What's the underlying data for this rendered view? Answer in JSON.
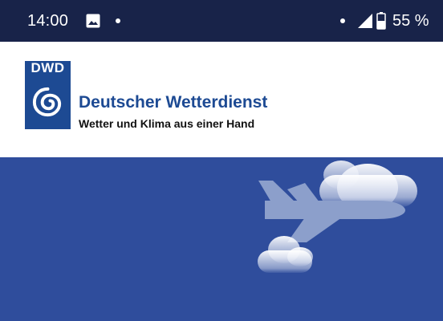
{
  "status_bar": {
    "time": "14:00",
    "battery_percent": "55 %",
    "icons": [
      "gallery-icon",
      "notification-dot-icon",
      "signal-icon",
      "battery-icon"
    ]
  },
  "header": {
    "logo_text": "DWD",
    "brand_name": "Deutscher Wetterdienst",
    "tagline": "Wetter und Klima aus einer Hand"
  },
  "hero": {
    "illustration": "airplane-with-clouds-icon"
  },
  "colors": {
    "status_bar_bg": "#182349",
    "brand_blue": "#1d4a93",
    "hero_bg": "#2f4d9c",
    "airplane": "#8c9fcb"
  }
}
